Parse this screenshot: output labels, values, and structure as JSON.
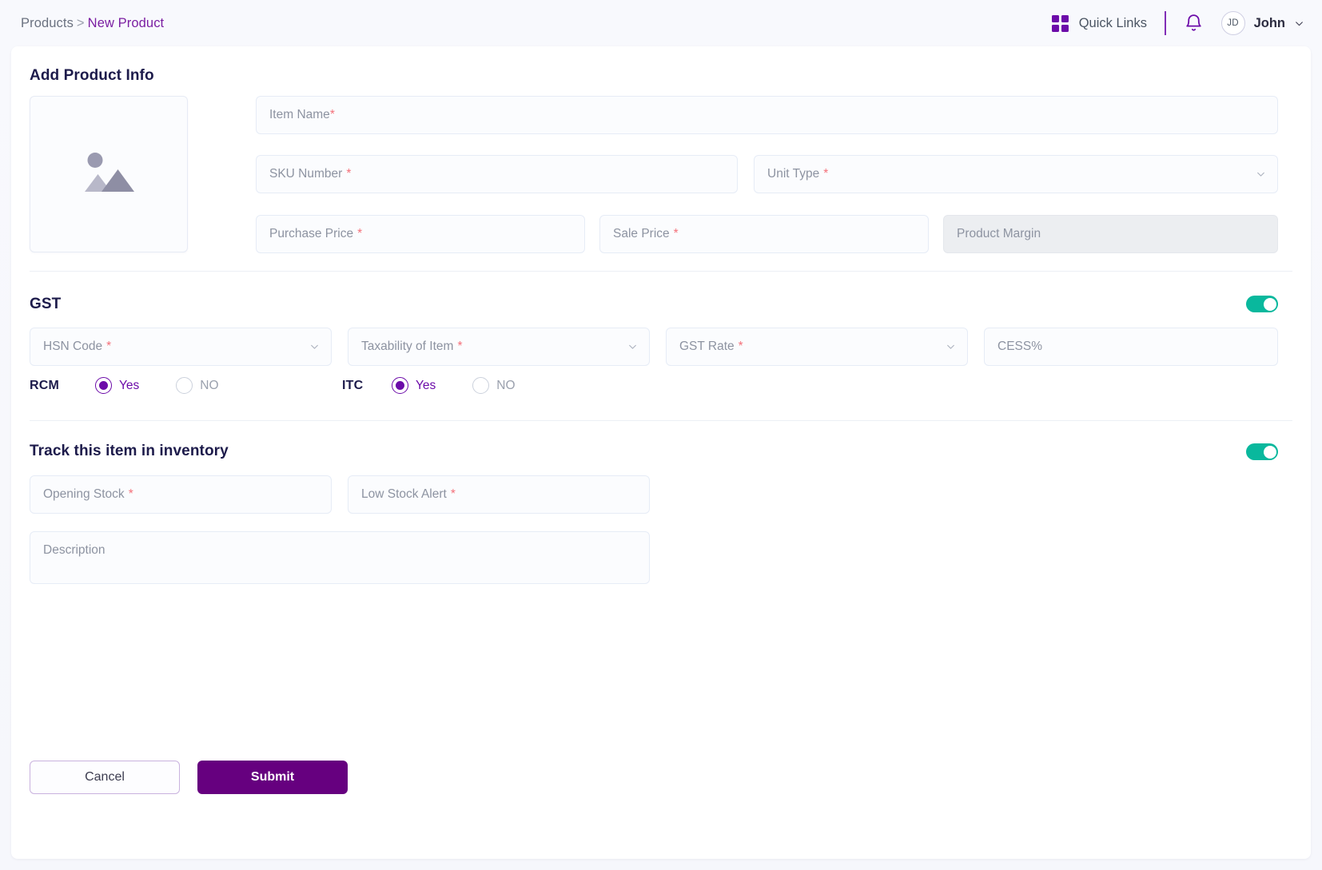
{
  "topbar": {
    "breadcrumb": {
      "root": "Products",
      "separator": ">",
      "current": "New Product"
    },
    "quick_links_label": "Quick Links",
    "quick_links_icon": "grid-icon",
    "notification_icon": "bell-icon",
    "avatar_initials": "JD",
    "username": "John",
    "user_menu_icon": "chevron-down-icon",
    "accent_color": "#6c0ba9"
  },
  "product_info": {
    "heading": "Add Product Info",
    "image_placeholder_icon": "image-placeholder-icon",
    "fields": {
      "item_name": {
        "placeholder": "Item Name",
        "required_mark": "*",
        "space_before_mark": false
      },
      "sku_number": {
        "placeholder": "SKU Number",
        "required_mark": "*",
        "space_before_mark": true
      },
      "unit_type": {
        "placeholder": "Unit Type",
        "required_mark": "*",
        "space_before_mark": true,
        "icon": "chevron-down-icon"
      },
      "purchase_price": {
        "placeholder": "Purchase Price",
        "required_mark": "*",
        "space_before_mark": true
      },
      "sale_price": {
        "placeholder": "Sale Price",
        "required_mark": "*",
        "space_before_mark": true
      },
      "product_margin": {
        "placeholder": "Product Margin",
        "required_mark": "",
        "disabled": true
      }
    }
  },
  "gst": {
    "heading": "GST",
    "enabled": true,
    "toggle_color": "#09b89d",
    "fields": {
      "hsn_code": {
        "placeholder": "HSN Code",
        "required_mark": "*",
        "icon": "chevron-down-icon"
      },
      "taxability_of_item": {
        "placeholder": "Taxability of Item",
        "required_mark": "*",
        "icon": "chevron-down-icon"
      },
      "gst_rate": {
        "placeholder": "GST Rate",
        "required_mark": "*",
        "icon": "chevron-down-icon"
      },
      "cess_percent": {
        "placeholder": "CESS%",
        "required_mark": ""
      }
    },
    "rcm": {
      "label": "RCM",
      "selected": "Yes",
      "options": [
        {
          "label": "Yes",
          "checked": true
        },
        {
          "label": "NO",
          "checked": false
        }
      ]
    },
    "itc": {
      "label": "ITC",
      "selected": "Yes",
      "options": [
        {
          "label": "Yes",
          "checked": true
        },
        {
          "label": "NO",
          "checked": false
        }
      ]
    }
  },
  "inventory": {
    "heading": "Track this item in inventory",
    "enabled": true,
    "toggle_color": "#09b89d",
    "fields": {
      "opening_stock": {
        "placeholder": "Opening Stock",
        "required_mark": "*"
      },
      "low_stock_alert": {
        "placeholder": "Low Stock Alert",
        "required_mark": "*"
      },
      "description": {
        "placeholder": "Description",
        "required_mark": ""
      }
    }
  },
  "actions": {
    "cancel_label": "Cancel",
    "submit_label": "Submit",
    "submit_color": "#66007f"
  }
}
